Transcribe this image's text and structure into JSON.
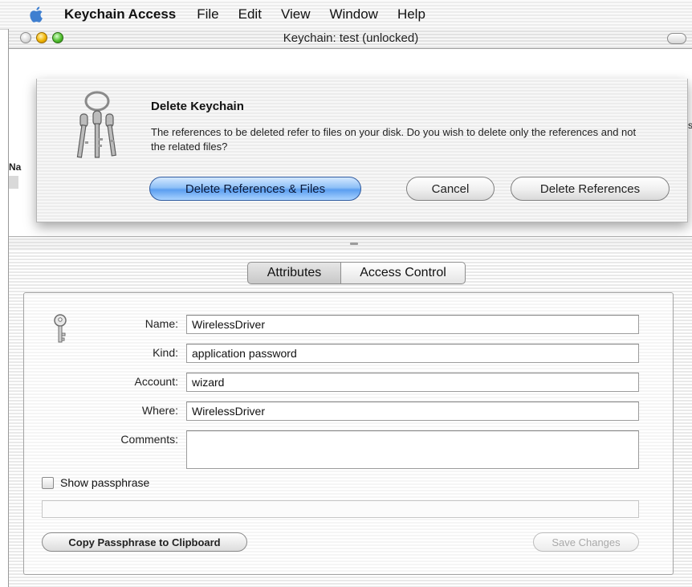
{
  "menubar": {
    "app_name": "Keychain Access",
    "items": [
      "File",
      "Edit",
      "View",
      "Window",
      "Help"
    ]
  },
  "window": {
    "title": "Keychain: test (unlocked)"
  },
  "upper": {
    "list_header_stub": "Na",
    "right_stub": "s"
  },
  "sheet": {
    "title": "Delete Keychain",
    "message": "The references to be deleted refer to files on your disk. Do you wish to delete only the references and not the related files?",
    "buttons": {
      "delete_refs_files": "Delete References & Files",
      "cancel": "Cancel",
      "delete_refs": "Delete References"
    }
  },
  "tabs": [
    "Attributes",
    "Access Control"
  ],
  "form": {
    "name_label": "Name:",
    "name_value": "WirelessDriver",
    "kind_label": "Kind:",
    "kind_value": "application password",
    "account_label": "Account:",
    "account_value": "wizard",
    "where_label": "Where:",
    "where_value": "WirelessDriver",
    "comments_label": "Comments:",
    "comments_value": ""
  },
  "show_passphrase_label": "Show passphrase",
  "buttons": {
    "copy": "Copy Passphrase to Clipboard",
    "save": "Save Changes"
  },
  "colors": {
    "default_button": "#5b9ef0",
    "disabled_text": "#a9a9a9"
  }
}
